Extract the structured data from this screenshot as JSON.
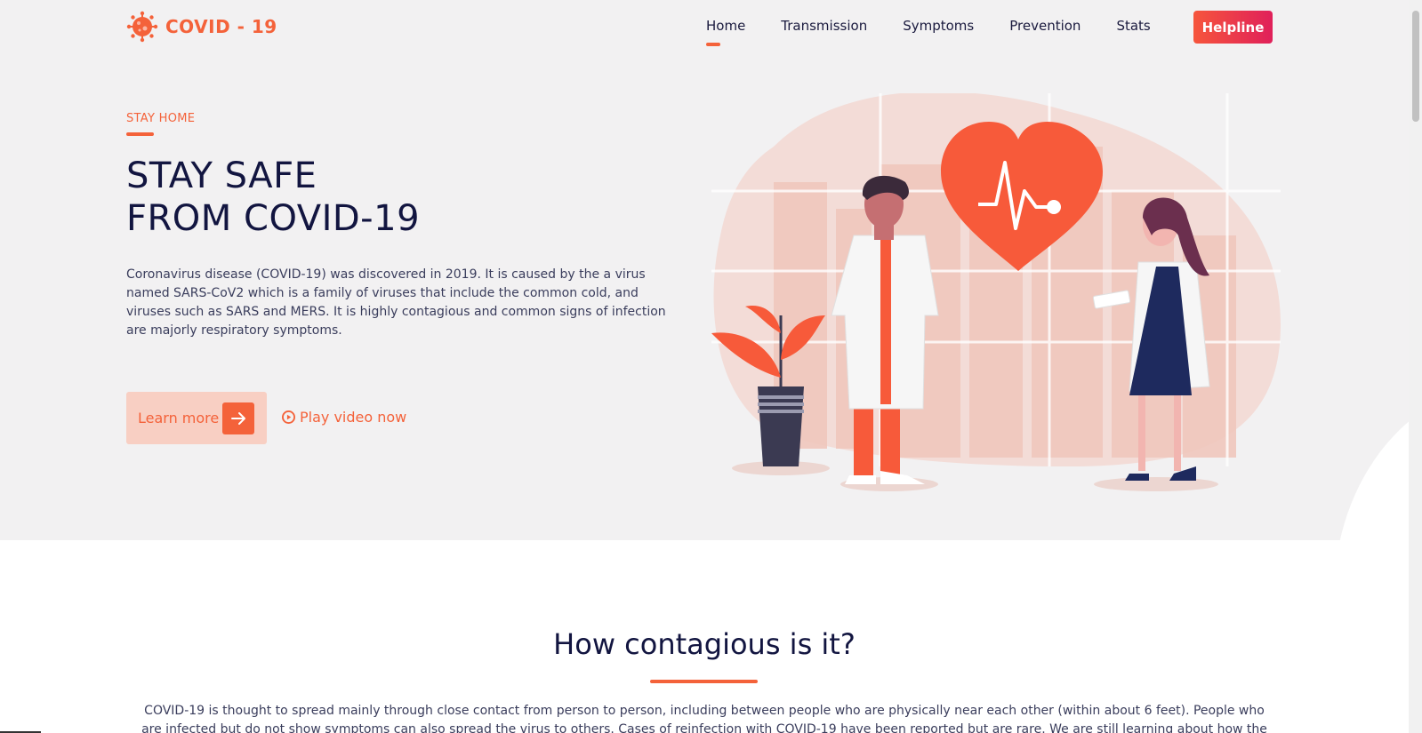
{
  "brand": {
    "name": "COVID - 19",
    "accent_color": "#f4623a",
    "icon": "virus-icon"
  },
  "nav": {
    "items": [
      {
        "label": "Home",
        "active": true
      },
      {
        "label": "Transmission",
        "active": false
      },
      {
        "label": "Symptoms",
        "active": false
      },
      {
        "label": "Prevention",
        "active": false
      },
      {
        "label": "Stats",
        "active": false
      }
    ],
    "helpline_label": "Helpline"
  },
  "hero": {
    "eyebrow": "STAY HOME",
    "headline_line1": "STAY SAFE",
    "headline_line2": "FROM COVID-19",
    "intro": "Coronavirus disease (COVID-19) was discovered in 2019. It is caused by the a virus named SARS-CoV2 which is a family of viruses that include the common cold, and viruses such as SARS and MERS. It is highly contagious and common signs of infection are majorly respiratory symptoms.",
    "learn_more_label": "Learn more",
    "play_video_label": "Play video now",
    "illustration": "doctors-heart-illustration"
  },
  "contagious": {
    "title": "How contagious is it?",
    "text": "COVID-19 is thought to spread mainly through close contact from person to person, including between people who are physically near each other (within about 6 feet). People who are infected but do not show symptoms can also spread the virus to others. Cases of reinfection with COVID-19 have been reported but are rare. We are still learning about how the virus"
  }
}
